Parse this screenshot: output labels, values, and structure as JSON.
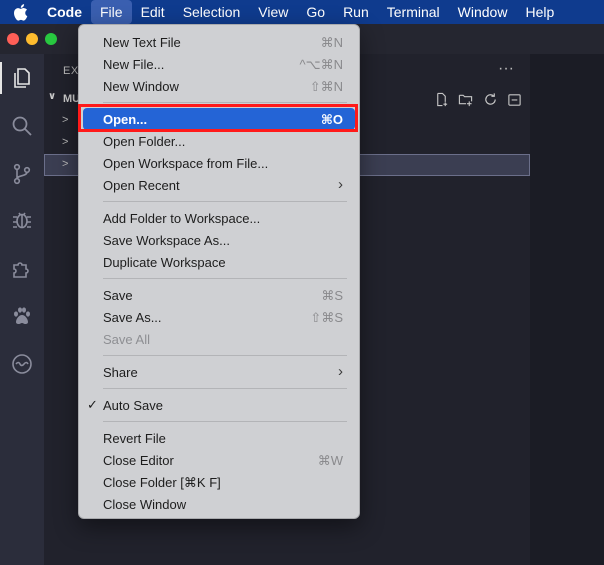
{
  "menubar": {
    "app": "Code",
    "items": [
      "File",
      "Edit",
      "Selection",
      "View",
      "Go",
      "Run",
      "Terminal",
      "Window",
      "Help"
    ]
  },
  "sidebar": {
    "title": "EX",
    "more": "···",
    "section": "MU"
  },
  "file_menu": {
    "new_text_file": {
      "label": "New Text File",
      "shortcut": "⌘N"
    },
    "new_file": {
      "label": "New File...",
      "shortcut": "^⌥⌘N"
    },
    "new_window": {
      "label": "New Window",
      "shortcut": "⇧⌘N"
    },
    "open": {
      "label": "Open...",
      "shortcut": "⌘O"
    },
    "open_folder": {
      "label": "Open Folder..."
    },
    "open_workspace": {
      "label": "Open Workspace from File..."
    },
    "open_recent": {
      "label": "Open Recent"
    },
    "add_folder": {
      "label": "Add Folder to Workspace..."
    },
    "save_workspace_as": {
      "label": "Save Workspace As..."
    },
    "duplicate_workspace": {
      "label": "Duplicate Workspace"
    },
    "save": {
      "label": "Save",
      "shortcut": "⌘S"
    },
    "save_as": {
      "label": "Save As...",
      "shortcut": "⇧⌘S"
    },
    "save_all": {
      "label": "Save All"
    },
    "share": {
      "label": "Share"
    },
    "auto_save": {
      "label": "Auto Save",
      "checked": true
    },
    "revert_file": {
      "label": "Revert File"
    },
    "close_editor": {
      "label": "Close Editor",
      "shortcut": "⌘W"
    },
    "close_folder": {
      "label": "Close Folder [⌘K F]"
    },
    "close_window": {
      "label": "Close Window"
    }
  },
  "colors": {
    "menubar_bg": "#0f3b8e",
    "highlight": "#2464d6",
    "annotation": "#ff1a1a"
  }
}
